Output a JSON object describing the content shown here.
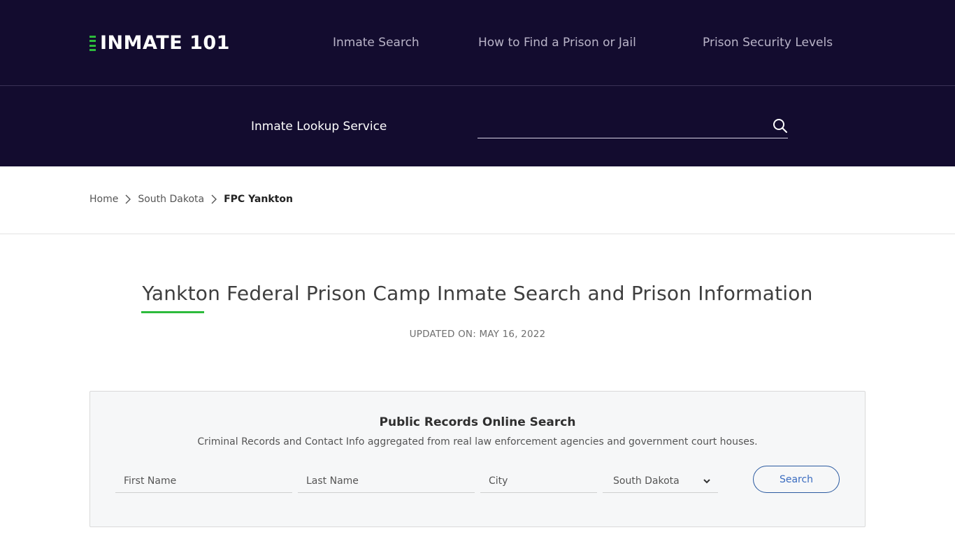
{
  "header": {
    "logo_text": "INMATE 101",
    "nav": [
      {
        "label": "Inmate Search"
      },
      {
        "label": "How to Find a Prison or Jail"
      },
      {
        "label": "Prison Security Levels"
      }
    ],
    "lookup_label": "Inmate Lookup Service",
    "lookup_input_value": "",
    "lookup_icon": "search-icon"
  },
  "breadcrumb": {
    "items": [
      {
        "label": "Home"
      },
      {
        "label": "South Dakota"
      }
    ],
    "current": "FPC Yankton",
    "separator_icon": "chevron-right-icon"
  },
  "page": {
    "title": "Yankton Federal Prison Camp Inmate Search and Prison Information",
    "updated": "UPDATED ON: MAY 16, 2022"
  },
  "search_card": {
    "title": "Public Records Online Search",
    "subtitle": "Criminal Records and Contact Info aggregated from real law enforcement agencies and government court houses.",
    "first_name_placeholder": "First Name",
    "last_name_placeholder": "Last Name",
    "city_placeholder": "City",
    "state_selected": "South Dakota",
    "search_label": "Search"
  },
  "colors": {
    "header_bg": "#130c2f",
    "accent_green": "#2dbb3c",
    "button_blue": "#2b5aa0"
  }
}
